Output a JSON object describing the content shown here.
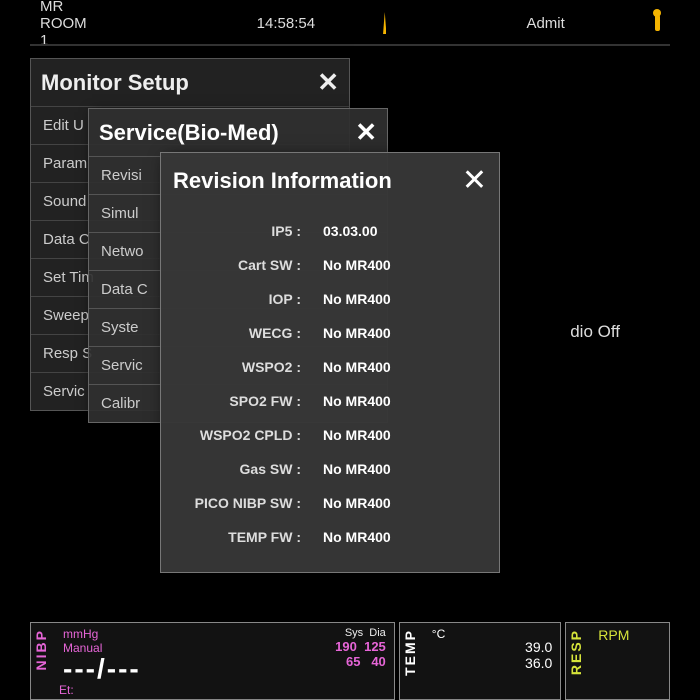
{
  "top": {
    "room": "MR ROOM 1",
    "time": "14:58:54",
    "admit": "Admit"
  },
  "panel1": {
    "title": "Monitor Setup",
    "items": [
      "Edit U",
      "Param",
      "Sound",
      "Data C",
      "Set Tim",
      "Sweep",
      "Resp S",
      "Servic"
    ]
  },
  "panel2": {
    "title": "Service(Bio-Med)",
    "items": [
      "Revisi",
      "Simul",
      "Netwo",
      "Data C",
      "Syste",
      "Servic",
      "Calibr"
    ]
  },
  "panel3": {
    "title": "Revision Information",
    "rows": [
      {
        "label": "IP5",
        "value": "03.03.00"
      },
      {
        "label": "Cart SW",
        "value": "No MR400"
      },
      {
        "label": "IOP",
        "value": "No MR400"
      },
      {
        "label": "WECG",
        "value": "No MR400"
      },
      {
        "label": "WSPO2",
        "value": "No MR400"
      },
      {
        "label": "SPO2 FW",
        "value": "No MR400"
      },
      {
        "label": "WSPO2 CPLD",
        "value": "No MR400"
      },
      {
        "label": "Gas SW",
        "value": "No MR400"
      },
      {
        "label": "PICO NIBP SW",
        "value": "No MR400"
      },
      {
        "label": "TEMP FW",
        "value": "No MR400"
      }
    ]
  },
  "bg": {
    "audioOff": "dio Off"
  },
  "vitals": {
    "nibp": {
      "tag": "NIBP",
      "unit": "mmHg",
      "mode": "Manual",
      "reading": "---/---",
      "sysLbl": "Sys",
      "diaLbl": "Dia",
      "sys1": "190",
      "dia1": "125",
      "sys2": "65",
      "dia2": "40",
      "et": "Et:"
    },
    "temp": {
      "tag": "TEMP",
      "unit": "°C",
      "v1": "39.0",
      "v2": "36.0"
    },
    "resp": {
      "tag": "RESP",
      "unit": "RPM"
    }
  }
}
